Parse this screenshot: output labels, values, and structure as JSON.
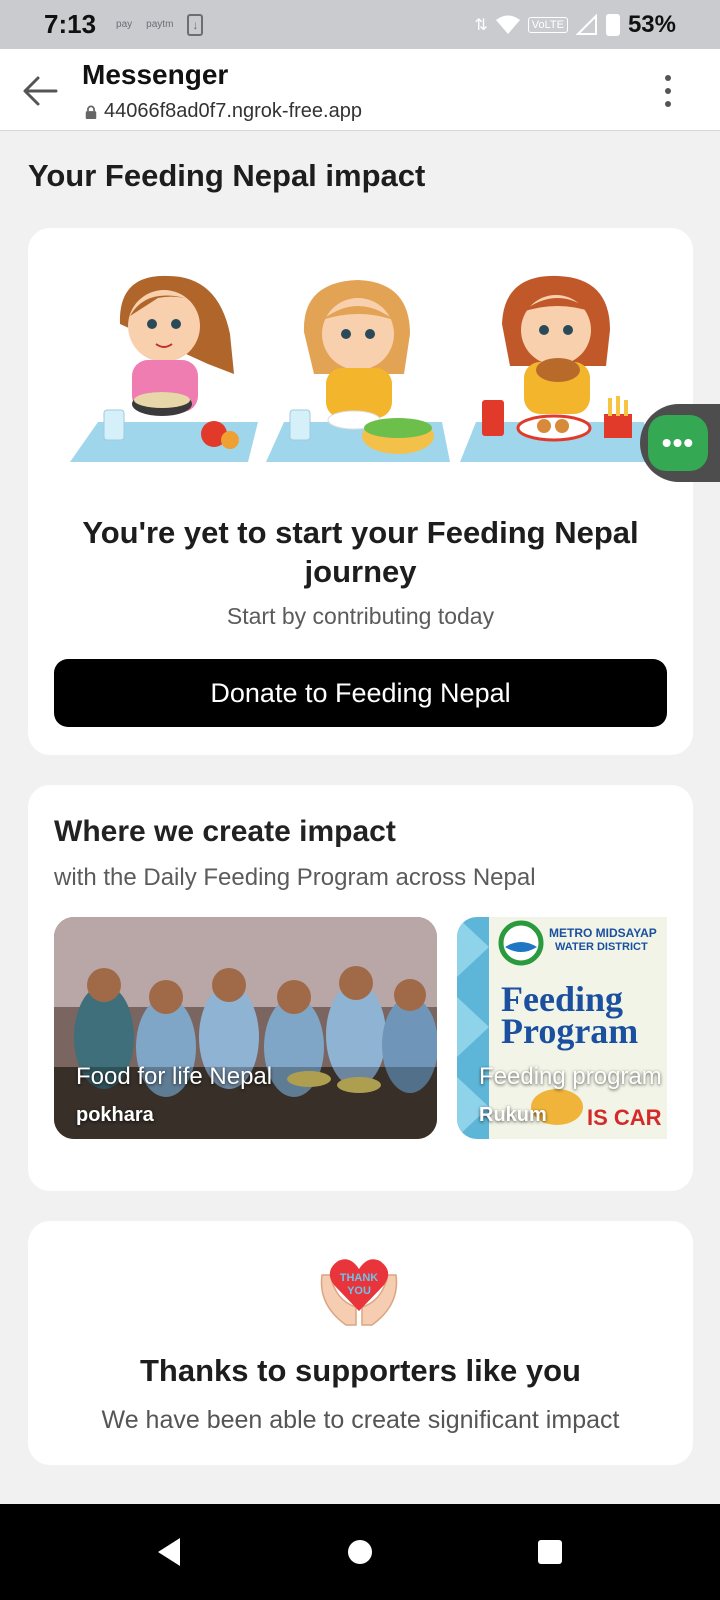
{
  "status_bar": {
    "time": "7:13",
    "left_icons": [
      "pay",
      "paytm",
      "download"
    ],
    "volte": "VoLTE",
    "battery": "53%"
  },
  "app_bar": {
    "title": "Messenger",
    "url": "44066f8ad0f7.ngrok-free.app"
  },
  "page": {
    "heading": "Your Feeding Nepal impact"
  },
  "journey_card": {
    "title": "You're yet to start your Feeding Nepal journey",
    "subtitle": "Start by contributing today",
    "donate_label": "Donate to Feeding Nepal"
  },
  "impact_card": {
    "title": "Where we create impact",
    "subtitle": "with the Daily Feeding Program across Nepal",
    "places": [
      {
        "name": "Food for life Nepal",
        "location": "pokhara"
      },
      {
        "name": "Feeding program",
        "location": "Rukum"
      }
    ],
    "poster": {
      "org": "METRO MIDSAYAP",
      "org2": "WATER DISTRICT",
      "line1": "Feeding",
      "line2": "Program",
      "tag": "IS CAR"
    }
  },
  "thanks_card": {
    "badge_text_1": "THANK",
    "badge_text_2": "YOU",
    "title": "Thanks to supporters like you",
    "subtitle": "We have been able to create significant impact"
  },
  "chat_bubble": {
    "label": "•••"
  },
  "colors": {
    "accent_green": "#34a853",
    "button_black": "#000000",
    "background": "#f1f1f1"
  }
}
